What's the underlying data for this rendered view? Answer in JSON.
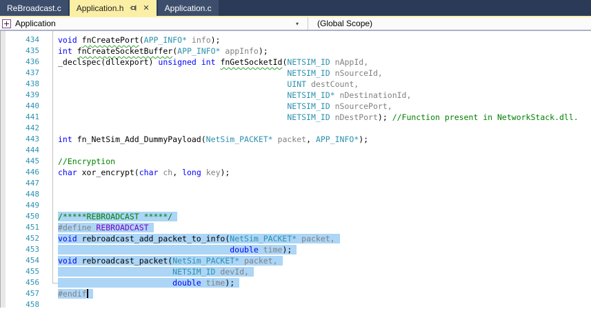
{
  "tabs": [
    {
      "label": "ReBroadcast.c",
      "state": "inactive"
    },
    {
      "label": "Application.h",
      "state": "active",
      "has_pin": true,
      "has_close": true
    },
    {
      "label": "Application.c",
      "state": "inactive"
    }
  ],
  "navbar": {
    "types_dropdown": "Application",
    "members_dropdown": "(Global Scope)"
  },
  "icons": {
    "close": "✕",
    "dropdown_arrow": "▾"
  },
  "colors": {
    "keyword": "#0000FF",
    "type": "#2B91AF",
    "param": "#808080",
    "comment": "#008000",
    "preproc": "#808080",
    "macro": "#7C00C8",
    "plain": "#000000",
    "selection": "#ACD5F6",
    "linenum": "#2B91AF",
    "squiggle": "#2EA32E",
    "tab_bar": "#2A3A57",
    "tab_inactive": "#3D4E6C",
    "tab_active": "#FBEFA6",
    "tab_text_active": "#1E1E1E",
    "tab_text_inactive": "#FFFFFF",
    "nav_bg": "#FBFBFC",
    "nav_border": "#A9B2C6",
    "gutter": "#E8E8E8",
    "outline": "#BFBFBF",
    "editor_bg": "#FFFFFF"
  },
  "code": {
    "first_line_number": 434,
    "lines": [
      {
        "num": 434,
        "indent": 0,
        "selected": false,
        "segments": [
          [
            "kw",
            "void"
          ],
          [
            "pl",
            " "
          ],
          [
            "fn",
            "fnCreatePort"
          ],
          [
            "pl",
            "("
          ],
          [
            "ty",
            "APP_INFO*"
          ],
          [
            "pl",
            " "
          ],
          [
            "pa",
            "info"
          ],
          [
            "pl",
            ");"
          ]
        ]
      },
      {
        "num": 435,
        "indent": 0,
        "selected": false,
        "segments": [
          [
            "kw",
            "int"
          ],
          [
            "pl",
            " "
          ],
          [
            "fn",
            "fnCreateSocketBuffer"
          ],
          [
            "pl",
            "("
          ],
          [
            "ty",
            "APP_INFO*"
          ],
          [
            "pl",
            " "
          ],
          [
            "pa",
            "appInfo"
          ],
          [
            "pl",
            ");"
          ]
        ]
      },
      {
        "num": 436,
        "indent": 0,
        "selected": false,
        "segments": [
          [
            "pl",
            "_declspec(dllexport) "
          ],
          [
            "kw",
            "unsigned"
          ],
          [
            "pl",
            " "
          ],
          [
            "kw",
            "int"
          ],
          [
            "pl",
            " "
          ],
          [
            "fn",
            "fnGetSocketId"
          ],
          [
            "pl",
            "("
          ],
          [
            "ty",
            "NETSIM_ID"
          ],
          [
            "pl",
            " "
          ],
          [
            "pa",
            "nAppId,"
          ]
        ]
      },
      {
        "num": 437,
        "indent": 48,
        "selected": false,
        "segments": [
          [
            "ty",
            "NETSIM_ID"
          ],
          [
            "pl",
            " "
          ],
          [
            "pa",
            "nSourceId,"
          ]
        ]
      },
      {
        "num": 438,
        "indent": 48,
        "selected": false,
        "segments": [
          [
            "ty",
            "UINT"
          ],
          [
            "pl",
            " "
          ],
          [
            "pa",
            "destCount,"
          ]
        ]
      },
      {
        "num": 439,
        "indent": 48,
        "selected": false,
        "segments": [
          [
            "ty",
            "NETSIM_ID*"
          ],
          [
            "pl",
            " "
          ],
          [
            "pa",
            "nDestinationId,"
          ]
        ]
      },
      {
        "num": 440,
        "indent": 48,
        "selected": false,
        "segments": [
          [
            "ty",
            "NETSIM_ID"
          ],
          [
            "pl",
            " "
          ],
          [
            "pa",
            "nSourcePort,"
          ]
        ]
      },
      {
        "num": 441,
        "indent": 48,
        "selected": false,
        "segments": [
          [
            "ty",
            "NETSIM_ID"
          ],
          [
            "pl",
            " "
          ],
          [
            "pa",
            "nDestPort"
          ],
          [
            "pl",
            "); "
          ],
          [
            "co",
            "//Function present in NetworkStack.dll."
          ]
        ]
      },
      {
        "num": 442,
        "indent": 0,
        "selected": false,
        "segments": []
      },
      {
        "num": 443,
        "indent": 0,
        "selected": false,
        "segments": [
          [
            "kw",
            "int"
          ],
          [
            "pl",
            " fn_NetSim_Add_DummyPayload("
          ],
          [
            "ty",
            "NetSim_PACKET*"
          ],
          [
            "pl",
            " "
          ],
          [
            "pa",
            "packet"
          ],
          [
            "pl",
            ", "
          ],
          [
            "ty",
            "APP_INFO*"
          ],
          [
            "pl",
            ");"
          ]
        ]
      },
      {
        "num": 444,
        "indent": 0,
        "selected": false,
        "segments": []
      },
      {
        "num": 445,
        "indent": 0,
        "selected": false,
        "segments": [
          [
            "co",
            "//Encryption"
          ]
        ]
      },
      {
        "num": 446,
        "indent": 0,
        "selected": false,
        "segments": [
          [
            "kw",
            "char"
          ],
          [
            "pl",
            " xor_encrypt("
          ],
          [
            "kw",
            "char"
          ],
          [
            "pl",
            " "
          ],
          [
            "pa",
            "ch"
          ],
          [
            "pl",
            ", "
          ],
          [
            "kw",
            "long"
          ],
          [
            "pl",
            " "
          ],
          [
            "pa",
            "key"
          ],
          [
            "pl",
            ");"
          ]
        ]
      },
      {
        "num": 447,
        "indent": 0,
        "selected": false,
        "segments": []
      },
      {
        "num": 448,
        "indent": 0,
        "selected": false,
        "segments": []
      },
      {
        "num": 449,
        "indent": 0,
        "selected": false,
        "segments": []
      },
      {
        "num": 450,
        "indent": 0,
        "selected": true,
        "segments": [
          [
            "co",
            "/*****REBROADCAST *****/"
          ]
        ]
      },
      {
        "num": 451,
        "indent": 0,
        "selected": true,
        "segments": [
          [
            "pp",
            "#define "
          ],
          [
            "mc",
            "REBROADCAST"
          ]
        ]
      },
      {
        "num": 452,
        "indent": 0,
        "selected": true,
        "segments": [
          [
            "kw",
            "void"
          ],
          [
            "pl",
            " rebroadcast_add_packet_to_info("
          ],
          [
            "ty",
            "NetSim_PACKET*"
          ],
          [
            "pl",
            " "
          ],
          [
            "pa",
            "packet,"
          ]
        ]
      },
      {
        "num": 453,
        "indent": 36,
        "selected": true,
        "segments": [
          [
            "kw",
            "double"
          ],
          [
            "pl",
            " "
          ],
          [
            "pa",
            "time"
          ],
          [
            "pl",
            ");"
          ]
        ]
      },
      {
        "num": 454,
        "indent": 0,
        "selected": true,
        "segments": [
          [
            "kw",
            "void"
          ],
          [
            "pl",
            " rebroadcast_packet("
          ],
          [
            "ty",
            "NetSim_PACKET*"
          ],
          [
            "pl",
            " "
          ],
          [
            "pa",
            "packet,"
          ]
        ]
      },
      {
        "num": 455,
        "indent": 24,
        "selected": true,
        "segments": [
          [
            "ty",
            "NETSIM_ID"
          ],
          [
            "pl",
            " "
          ],
          [
            "pa",
            "devId,"
          ]
        ]
      },
      {
        "num": 456,
        "indent": 24,
        "selected": true,
        "segments": [
          [
            "kw",
            "double"
          ],
          [
            "pl",
            " "
          ],
          [
            "pa",
            "time"
          ],
          [
            "pl",
            ");"
          ]
        ]
      },
      {
        "num": 457,
        "indent": 0,
        "selected": true,
        "caret": true,
        "segments": [
          [
            "pp",
            "#endif"
          ]
        ]
      },
      {
        "num": 458,
        "indent": 0,
        "selected": false,
        "segments": []
      }
    ]
  }
}
